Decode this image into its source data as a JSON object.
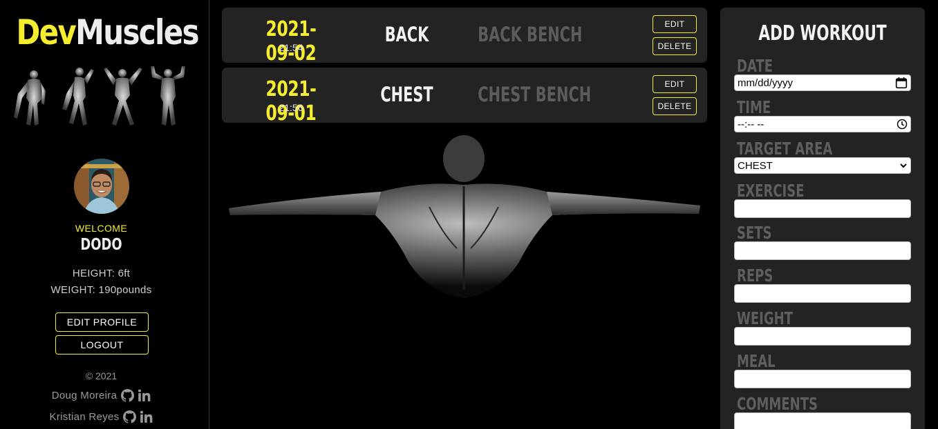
{
  "brand": {
    "dev": "Dev",
    "muscles": "Muscles"
  },
  "profile": {
    "welcome": "WELCOME",
    "name": "DODO",
    "height": "HEIGHT: 6ft",
    "weight": "WEIGHT: 190pounds",
    "edit_label": "EDIT PROFILE",
    "logout_label": "LOGOUT"
  },
  "footer": {
    "copyright": "© 2021",
    "authors": [
      {
        "name": "Doug Moreira"
      },
      {
        "name": "Kristian Reyes"
      }
    ]
  },
  "workouts": [
    {
      "date": "2021-09-02",
      "time": "21:54",
      "area": "BACK",
      "exercise": "BACK BENCH",
      "edit": "EDIT",
      "delete": "DELETE"
    },
    {
      "date": "2021-09-01",
      "time": "21:56",
      "area": "CHEST",
      "exercise": "CHEST BENCH",
      "edit": "EDIT",
      "delete": "DELETE"
    }
  ],
  "form": {
    "title": "ADD WORKOUT",
    "date_label": "DATE",
    "date_placeholder": "mm/dd/yyyy",
    "time_label": "TIME",
    "time_placeholder": "--:-- --",
    "target_label": "TARGET AREA",
    "target_value": "CHEST",
    "exercise_label": "EXERCISE",
    "sets_label": "SETS",
    "reps_label": "REPS",
    "weight_label": "WEIGHT",
    "meal_label": "MEAL",
    "comments_label": "COMMENTS"
  },
  "colors": {
    "accent": "#f5ee2f",
    "card": "#232323",
    "muted": "#5e5e5e"
  }
}
